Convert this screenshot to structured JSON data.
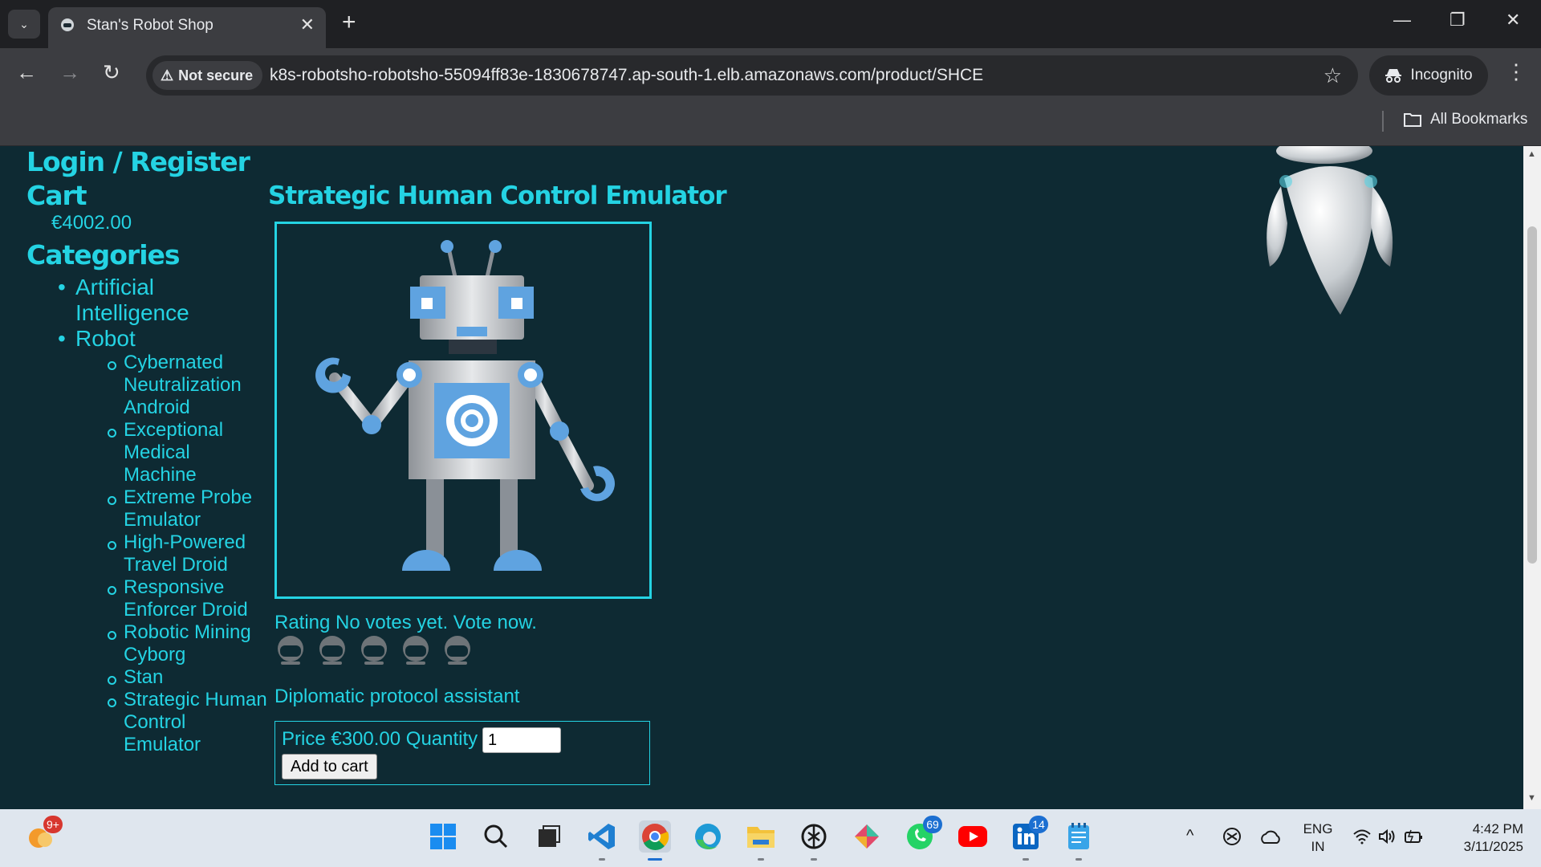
{
  "browser": {
    "tab_title": "Stan's Robot Shop",
    "not_secure_label": "Not secure",
    "url": "k8s-robotsho-robotsho-55094ff83e-1830678747.ap-south-1.elb.amazonaws.com/product/SHCE",
    "incognito_label": "Incognito",
    "all_bookmarks_label": "All Bookmarks"
  },
  "sidebar": {
    "login_label": "Login / Register",
    "cart_heading": "Cart",
    "cart_total": "€4002.00",
    "categories_heading": "Categories",
    "categories": [
      {
        "label": "Artificial Intelligence"
      },
      {
        "label": "Robot"
      }
    ],
    "robot_items": [
      {
        "label": "Cybernated Neutralization Android"
      },
      {
        "label": "Exceptional Medical Machine"
      },
      {
        "label": "Extreme Probe Emulator"
      },
      {
        "label": "High-Powered Travel Droid"
      },
      {
        "label": "Responsive Enforcer Droid"
      },
      {
        "label": "Robotic Mining Cyborg"
      },
      {
        "label": "Stan"
      },
      {
        "label": "Strategic Human Control Emulator"
      }
    ]
  },
  "product": {
    "title": "Strategic Human Control Emulator",
    "rating_text": "Rating No votes yet. Vote now.",
    "votes": 0,
    "vote_max": 5,
    "description": "Diplomatic protocol assistant",
    "price_text": "Price €300.00 Quantity",
    "quantity": "1",
    "add_to_cart_label": "Add to cart"
  },
  "taskbar": {
    "notification_badge": "9+",
    "whatsapp_badge": "69",
    "linkedin_badge": "14",
    "language_line1": "ENG",
    "language_line2": "IN",
    "time": "4:42 PM",
    "date": "3/11/2025"
  },
  "colors": {
    "accent": "#24d3e3",
    "page_bg": "#0e2a33",
    "chrome_bg": "#3c3d41"
  }
}
